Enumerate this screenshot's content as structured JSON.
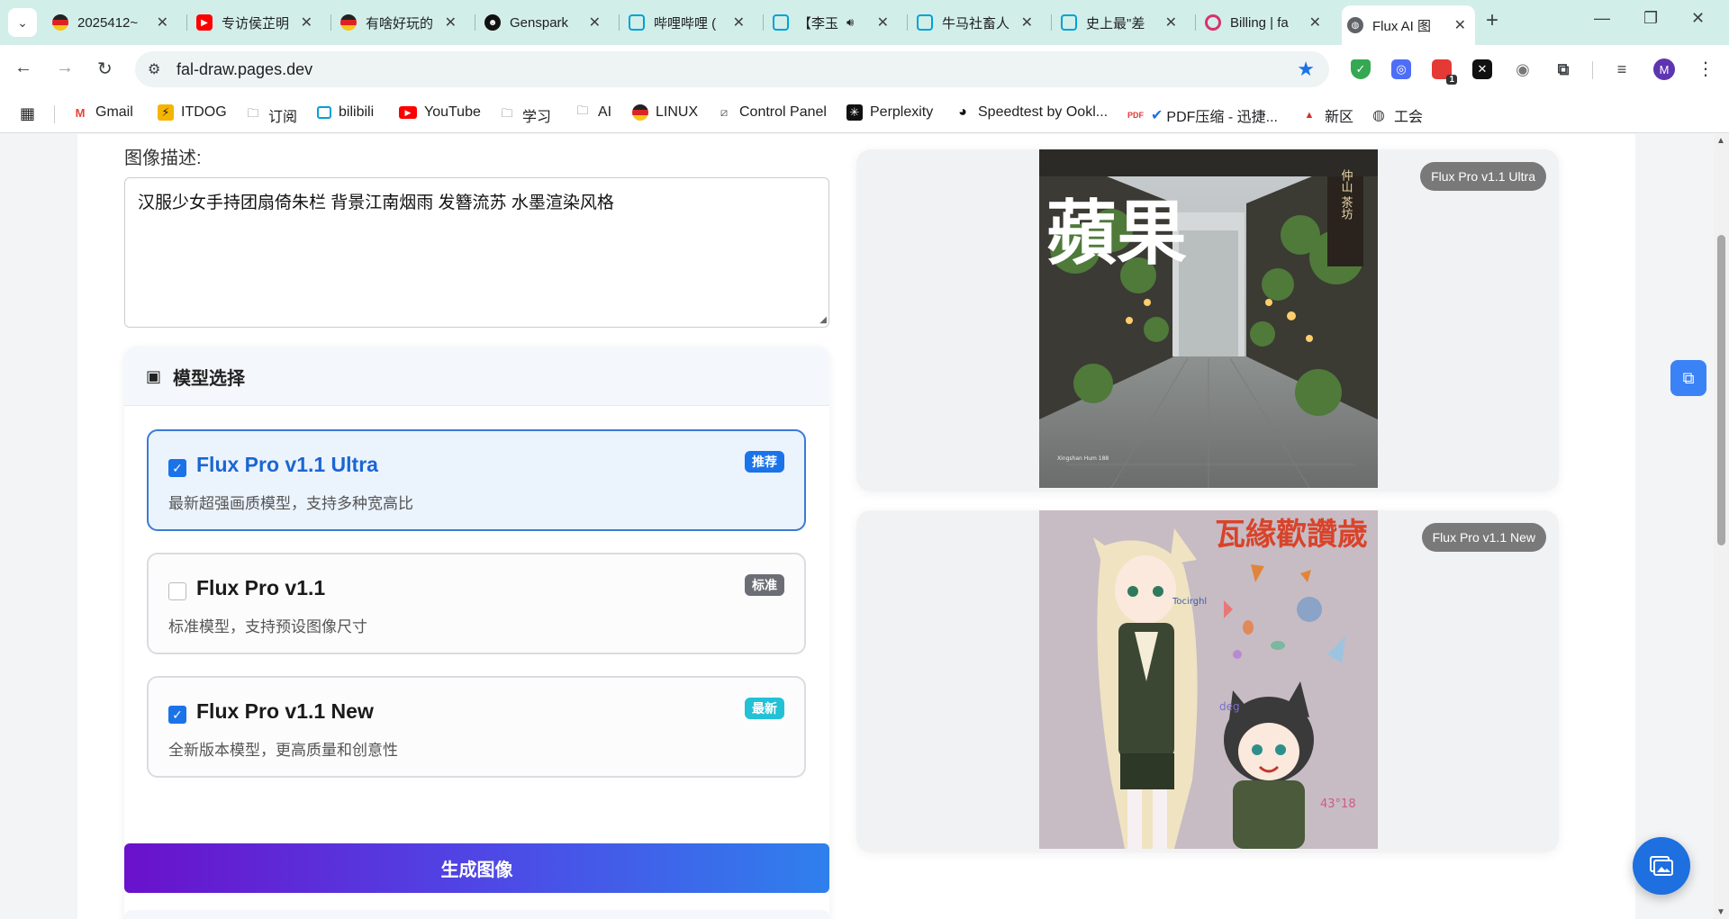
{
  "browser": {
    "tabs": [
      {
        "title": "2025412~",
        "favicon": "round-flag-icon"
      },
      {
        "title": "专访侯芷明",
        "favicon": "youtube-icon"
      },
      {
        "title": "有啥好玩的",
        "favicon": "round-flag-icon"
      },
      {
        "title": "Genspark",
        "favicon": "genspark-icon"
      },
      {
        "title": "哔哩哔哩 (",
        "favicon": "bilibili-icon"
      },
      {
        "title": "【李玉",
        "favicon": "bilibili-icon"
      },
      {
        "title": "牛马社畜人",
        "favicon": "bilibili-icon"
      },
      {
        "title": "史上最\"差",
        "favicon": "bilibili-icon"
      },
      {
        "title": "Billing | fa",
        "favicon": "fal-icon"
      },
      {
        "title": "Flux AI 图",
        "favicon": "globe-icon",
        "active": true
      }
    ],
    "url": "fal-draw.pages.dev",
    "avatar_letter": "M",
    "extension_badge": "1",
    "bookmarks": [
      {
        "label": "Gmail",
        "icon": "gmail-icon"
      },
      {
        "label": "ITDOG",
        "icon": "itdog-icon"
      },
      {
        "label": "订阅",
        "icon": "folder-icon"
      },
      {
        "label": "bilibili",
        "icon": "bilibili-icon"
      },
      {
        "label": "YouTube",
        "icon": "youtube-icon"
      },
      {
        "label": "学习",
        "icon": "folder-icon"
      },
      {
        "label": "AI",
        "icon": "folder-icon"
      },
      {
        "label": "LINUX",
        "icon": "linux-icon"
      },
      {
        "label": "Control Panel",
        "icon": "control-panel-icon"
      },
      {
        "label": "Perplexity",
        "icon": "perplexity-icon"
      },
      {
        "label": "Speedtest by Ookl...",
        "icon": "speedtest-icon"
      },
      {
        "label": "PDF压缩 - 迅捷...",
        "icon": "pdf-icon"
      },
      {
        "label": "新区",
        "icon": "news-icon"
      },
      {
        "label": "工会",
        "icon": "globe-icon"
      }
    ]
  },
  "form": {
    "description_label": "图像描述:",
    "description_value": "汉服少女手持团扇倚朱栏 背景江南烟雨 发簪流苏 水墨渲染风格"
  },
  "models": {
    "title": "模型选择",
    "options": [
      {
        "name": "Flux Pro v1.1 Ultra",
        "desc": "最新超强画质模型，支持多种宽高比",
        "badge": "推荐",
        "badge_color": "#1a73e8",
        "checked": true
      },
      {
        "name": "Flux Pro v1.1",
        "desc": "标准模型，支持预设图像尺寸",
        "badge": "标准",
        "badge_color": "#6b6f75",
        "checked": false
      },
      {
        "name": "Flux Pro v1.1 New",
        "desc": "全新版本模型，更高质量和创意性",
        "badge": "最新",
        "badge_color": "#22c1d6",
        "checked": true
      }
    ]
  },
  "generate_label": "生成图像",
  "results": [
    {
      "model": "Flux Pro v1.1 Ultra",
      "calligraphy": "蘋果",
      "sign_right": "仲山 茶坊",
      "caption": "Xingshan Hum 188"
    },
    {
      "model": "Flux Pro v1.1 New",
      "title_text": "瓦緣歡讚歲",
      "doodle_1": "Tocirghl",
      "doodle_2": "deg",
      "doodle_3": "43°18"
    }
  ]
}
